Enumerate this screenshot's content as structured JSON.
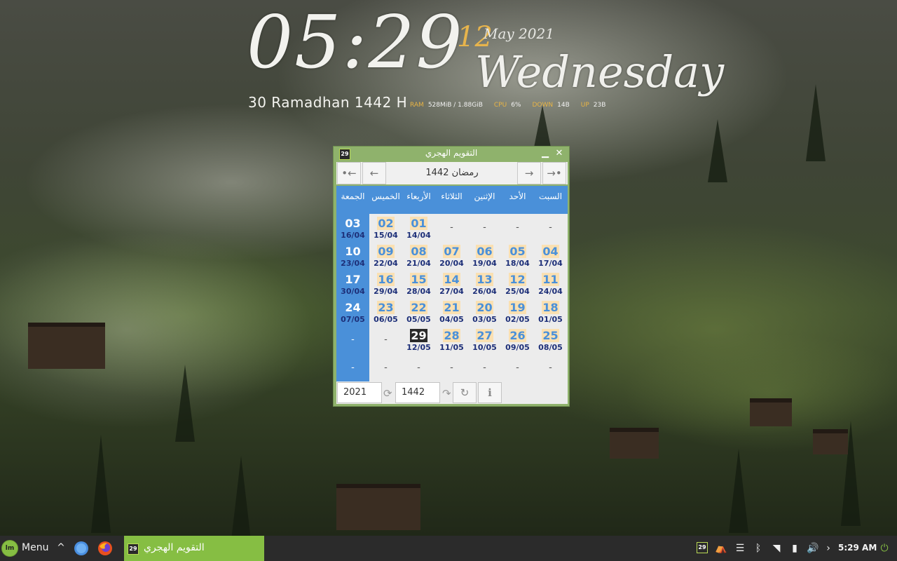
{
  "conky": {
    "time": "05:29",
    "day": "12",
    "month_year": "May 2021",
    "weekday": "Wednesday",
    "hijri_date": "30 Ramadhan 1442 H",
    "stats": [
      {
        "label": "RAM",
        "value": "528MiB / 1.88GiB"
      },
      {
        "label": "CPU",
        "value": "6%"
      },
      {
        "label": "DOWN",
        "value": "14B"
      },
      {
        "label": "UP",
        "value": "23B"
      }
    ]
  },
  "window": {
    "title": "التقويم الهجري",
    "icon_text": "29",
    "minimize": "▁",
    "close": "✕",
    "nav": {
      "prev_year": "•←",
      "prev_month": "←",
      "month_label": "رمضان 1442",
      "next_month": "→",
      "next_year": "→•"
    },
    "weekdays": [
      "السبت",
      "الأحد",
      "الإثنين",
      "الثلاثاء",
      "الأربعاء",
      "الخميس",
      "الجمعة"
    ],
    "weeks": [
      [
        {
          "d": "-"
        },
        {
          "d": "-"
        },
        {
          "d": "-"
        },
        {
          "d": "-"
        },
        {
          "d": "01",
          "g": "14/04"
        },
        {
          "d": "02",
          "g": "15/04"
        },
        {
          "d": "03",
          "g": "16/04"
        }
      ],
      [
        {
          "d": "04",
          "g": "17/04"
        },
        {
          "d": "05",
          "g": "18/04"
        },
        {
          "d": "06",
          "g": "19/04"
        },
        {
          "d": "07",
          "g": "20/04"
        },
        {
          "d": "08",
          "g": "21/04"
        },
        {
          "d": "09",
          "g": "22/04"
        },
        {
          "d": "10",
          "g": "23/04"
        }
      ],
      [
        {
          "d": "11",
          "g": "24/04"
        },
        {
          "d": "12",
          "g": "25/04"
        },
        {
          "d": "13",
          "g": "26/04"
        },
        {
          "d": "14",
          "g": "27/04"
        },
        {
          "d": "15",
          "g": "28/04"
        },
        {
          "d": "16",
          "g": "29/04"
        },
        {
          "d": "17",
          "g": "30/04"
        }
      ],
      [
        {
          "d": "18",
          "g": "01/05"
        },
        {
          "d": "19",
          "g": "02/05"
        },
        {
          "d": "20",
          "g": "03/05"
        },
        {
          "d": "21",
          "g": "04/05"
        },
        {
          "d": "22",
          "g": "05/05"
        },
        {
          "d": "23",
          "g": "06/05"
        },
        {
          "d": "24",
          "g": "07/05"
        }
      ],
      [
        {
          "d": "25",
          "g": "08/05"
        },
        {
          "d": "26",
          "g": "09/05"
        },
        {
          "d": "27",
          "g": "10/05"
        },
        {
          "d": "28",
          "g": "11/05"
        },
        {
          "d": "29",
          "g": "12/05",
          "today": true
        },
        {
          "d": "-"
        },
        {
          "d": "-"
        }
      ],
      [
        {
          "d": "-"
        },
        {
          "d": "-"
        },
        {
          "d": "-"
        },
        {
          "d": "-"
        },
        {
          "d": "-"
        },
        {
          "d": "-"
        },
        {
          "d": "-"
        }
      ]
    ],
    "year_input": "2021",
    "hijri_year_input": "1442",
    "refresh_icon": "↻",
    "info_icon": "ℹ"
  },
  "taskbar": {
    "menu_label": "Menu",
    "menu_logo": "lm",
    "up_arrow": "^",
    "task_label": "التقويم الهجري",
    "tray_icon_text": "29",
    "clock": "5:29 AM"
  }
}
